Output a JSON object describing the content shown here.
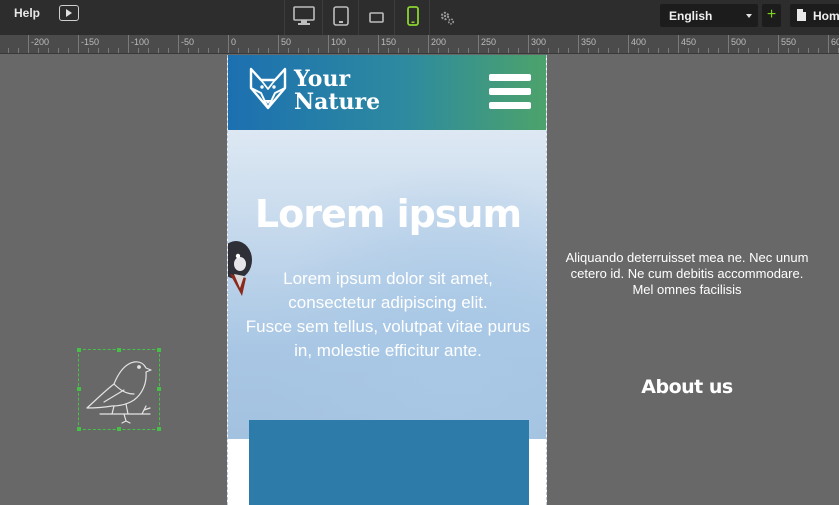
{
  "toolbar": {
    "help_label": "Help",
    "devices": [
      "desktop-icon",
      "tablet-icon",
      "landscape-icon",
      "mobile-icon",
      "settings-icon"
    ],
    "active_device": "mobile",
    "language": "English",
    "add_label": "+",
    "page_select": "Home"
  },
  "ruler": {
    "labels": [
      "-200",
      "-150",
      "-100",
      "-50",
      "0",
      "50",
      "100",
      "150",
      "200",
      "250",
      "300",
      "350",
      "400",
      "450",
      "500",
      "550",
      "60"
    ]
  },
  "site": {
    "logo_line1": "Your",
    "logo_line2": "Nature",
    "hero_title": "Lorem ipsum",
    "hero_text_line1": "Lorem ipsum dolor sit amet,",
    "hero_text_line2": "consectetur adipiscing elit.",
    "hero_text_line3": "Fusce sem tellus, volutpat vitae purus",
    "hero_text_line4": "in, molestie efficitur ante."
  },
  "side": {
    "text_line1": "Aliquando deterruisset mea ne. Nec unum",
    "text_line2": "cetero id. Ne cum debitis accommodare.",
    "text_line3": "Mel omnes facilisis",
    "about_heading": "About us"
  },
  "colors": {
    "toolbar_bg": "#2d2d2d",
    "canvas_bg": "#686868",
    "header_start": "#1c70b0",
    "header_end": "#4da36a",
    "active_device": "#8bd32e",
    "block_blue": "#2d7ba9"
  }
}
